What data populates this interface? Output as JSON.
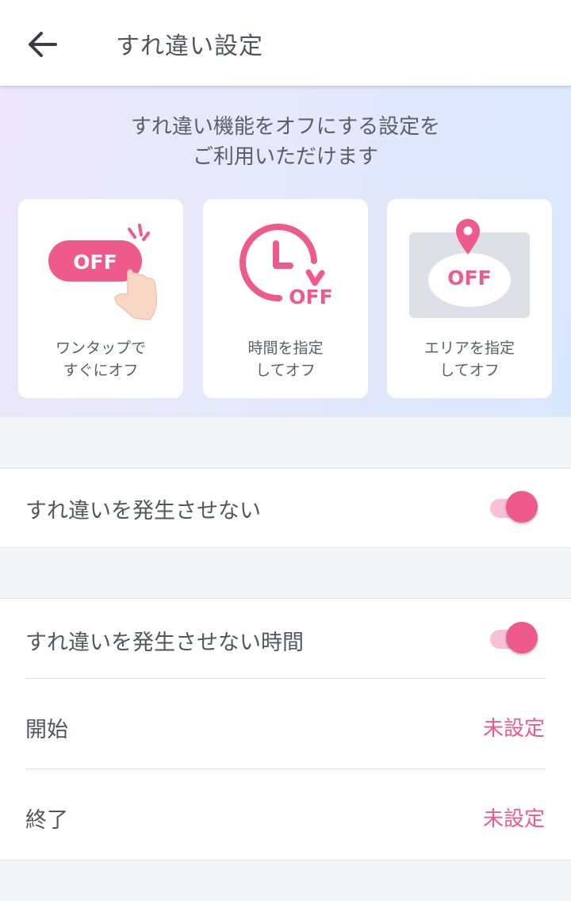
{
  "header": {
    "title": "すれ違い設定"
  },
  "hero": {
    "line1": "すれ違い機能をオフにする設定を",
    "line2": "ご利用いただけます",
    "cards": [
      {
        "line1": "ワンタップで",
        "line2": "すぐにオフ",
        "badge": "OFF",
        "icon": "tap-toggle-off-icon"
      },
      {
        "line1": "時間を指定",
        "line2": "してオフ",
        "badge": "OFF",
        "icon": "clock-off-icon"
      },
      {
        "line1": "エリアを指定",
        "line2": "してオフ",
        "badge": "OFF",
        "icon": "map-pin-off-icon"
      }
    ]
  },
  "settings": {
    "disable_passby": {
      "label": "すれ違いを発生させない",
      "enabled": true
    },
    "disable_time": {
      "label": "すれ違いを発生させない時間",
      "enabled": true
    },
    "start": {
      "label": "開始",
      "value": "未設定"
    },
    "end": {
      "label": "終了",
      "value": "未設定"
    }
  },
  "colors": {
    "accent": "#ee5a8c",
    "accent_light": "#f7c1d5"
  }
}
